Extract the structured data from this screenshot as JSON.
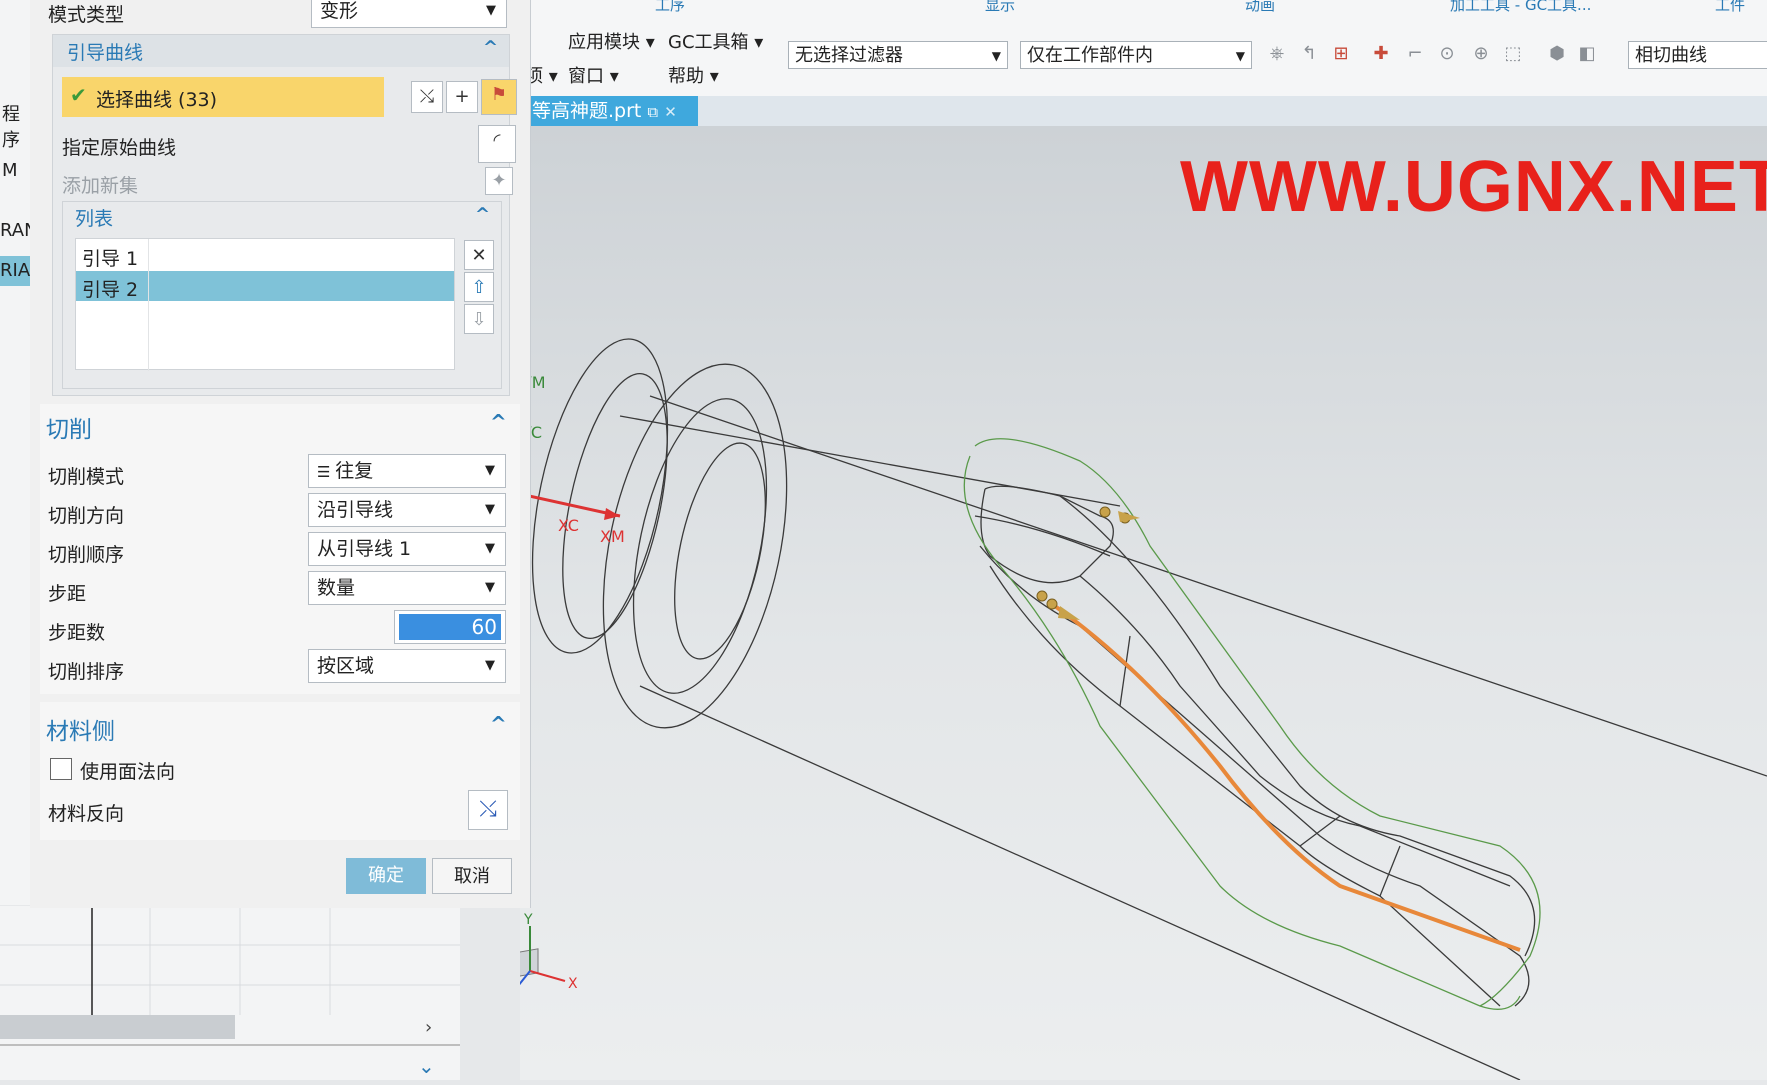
{
  "window": {
    "mode_type_label": "模式类型",
    "mode_type_value": "变形"
  },
  "guide_curves": {
    "title": "引导曲线",
    "select_curve_label": "选择曲线 (33)",
    "specify_original_label": "指定原始曲线",
    "add_new_set_label": "添加新集",
    "list_title": "列表",
    "list_items": [
      "引导 1",
      "引导 2"
    ]
  },
  "cut": {
    "title": "切削",
    "rows": [
      {
        "label": "切削模式",
        "value": "往复"
      },
      {
        "label": "切削方向",
        "value": "沿引导线"
      },
      {
        "label": "切削顺序",
        "value": "从引导线 1"
      },
      {
        "label": "步距",
        "value": "数量"
      }
    ],
    "stepcount_label": "步距数",
    "stepcount_value": "60",
    "sort_label": "切削排序",
    "sort_value": "按区域"
  },
  "material": {
    "title": "材料侧",
    "use_face_normal_label": "使用面法向",
    "reverse_label": "材料反向"
  },
  "buttons": {
    "ok": "确定",
    "cancel": "取消"
  },
  "toolbar": {
    "group_headers": [
      "工序",
      "显示",
      "动画",
      "加工工具 - GC工具...",
      "工件"
    ],
    "menus": [
      "应用模块",
      "GC工具箱",
      "窗口",
      "帮助"
    ],
    "partial_menu": "项",
    "filter_value": "无选择过滤器",
    "scope_value": "仅在工作部件内",
    "curve_rule": "相切曲线"
  },
  "file_tab": "等高神题.prt",
  "watermark": "WWW.UGNX.NET",
  "viewport_labels": {
    "ym": "YM",
    "yc": "YC",
    "xc": "XC",
    "xm": "XM",
    "axis_y": "Y",
    "axis_x": "X"
  },
  "left_fragments": [
    "程序",
    "M",
    "RAN",
    "RIAI"
  ],
  "colors": {
    "accent": "#2a7ab5",
    "selected_row": "#7fc2d8",
    "highlight": "#f9d56b",
    "ok_button": "#7fbbd8",
    "watermark": "#e8211b",
    "tool_path": "#e8883a"
  }
}
